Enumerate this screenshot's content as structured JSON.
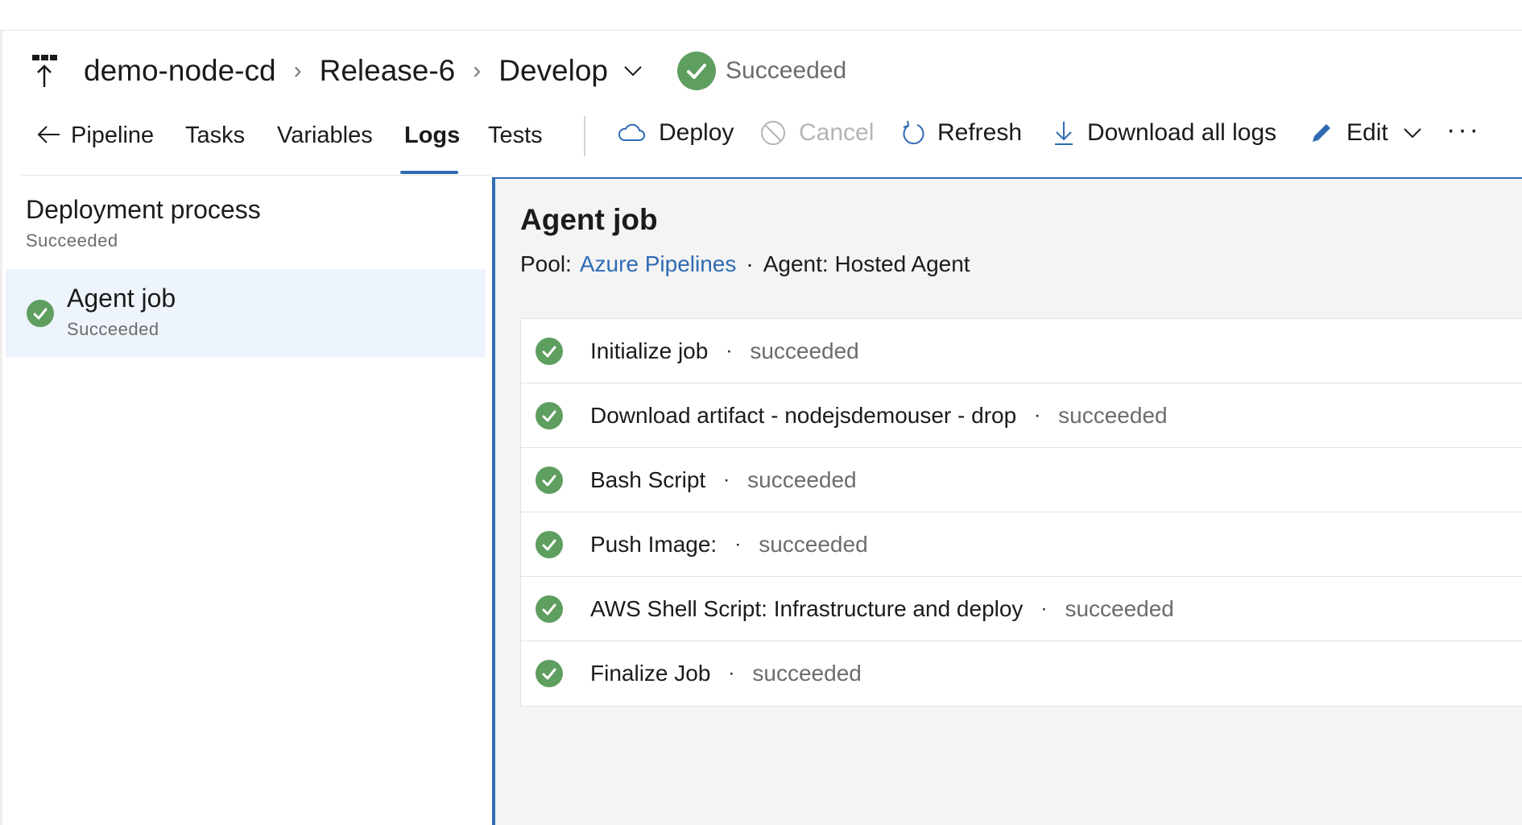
{
  "header": {
    "breadcrumb": [
      "demo-node-cd",
      "Release-6",
      "Develop"
    ],
    "status": "Succeeded"
  },
  "tabs": [
    "Pipeline",
    "Tasks",
    "Variables",
    "Logs",
    "Tests"
  ],
  "active_tab": "Logs",
  "toolbar": {
    "deploy": "Deploy",
    "cancel": "Cancel",
    "refresh": "Refresh",
    "download": "Download all logs",
    "edit": "Edit",
    "more": "···"
  },
  "left_panel": {
    "process_title": "Deployment process",
    "process_status": "Succeeded",
    "job_name": "Agent job",
    "job_status": "Succeeded"
  },
  "right_panel": {
    "title": "Agent job",
    "pool_label": "Pool:",
    "pool_link": "Azure Pipelines",
    "agent": "Agent: Hosted Agent",
    "dot": "·",
    "steps": [
      {
        "name": "Initialize job",
        "status": "succeeded"
      },
      {
        "name": "Download artifact - nodejsdemouser - drop",
        "status": "succeeded"
      },
      {
        "name": "Bash Script",
        "status": "succeeded"
      },
      {
        "name": "Push Image:",
        "status": "succeeded"
      },
      {
        "name": "AWS Shell Script: Infrastructure and deploy",
        "status": "succeeded"
      },
      {
        "name": "Finalize Job",
        "status": "succeeded"
      }
    ]
  },
  "colors": {
    "success": "#5e9e5f",
    "accent": "#2f6bb3",
    "selected_bg": "#eef4fc",
    "panel_bg": "#f4f4f4"
  }
}
